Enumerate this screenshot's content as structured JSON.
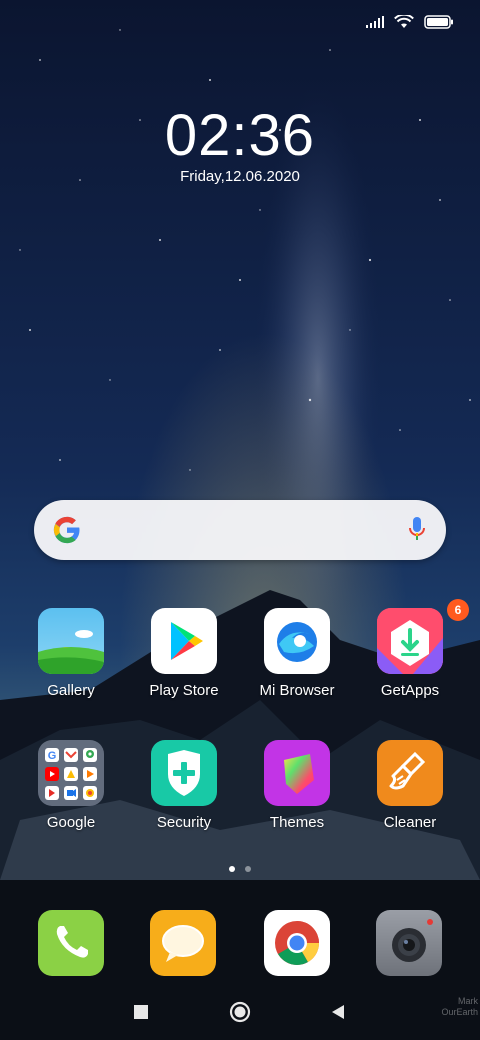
{
  "status_bar": {
    "signal_icon": "signal-icon",
    "wifi_icon": "wifi-icon",
    "battery_icon": "battery-icon"
  },
  "clock": {
    "time": "02:36",
    "date": "Friday,12.06.2020"
  },
  "search_bar": {
    "logo": "google-g-icon",
    "mic": "mic-icon"
  },
  "apps_row1": [
    {
      "label": "Gallery"
    },
    {
      "label": "Play Store"
    },
    {
      "label": "Mi Browser"
    },
    {
      "label": "GetApps",
      "badge": "6"
    }
  ],
  "apps_row2": [
    {
      "label": "Google"
    },
    {
      "label": "Security"
    },
    {
      "label": "Themes"
    },
    {
      "label": "Cleaner"
    }
  ],
  "page_indicator": {
    "pages": 2,
    "current": 1
  },
  "dock": [
    {
      "icon": "phone-icon"
    },
    {
      "icon": "messages-icon"
    },
    {
      "icon": "chrome-icon"
    },
    {
      "icon": "camera-icon"
    }
  ],
  "nav_bar": {
    "recents": "recents-icon",
    "home": "home-icon",
    "back": "back-icon"
  },
  "watermark": {
    "line1": "Mark",
    "line2": "OurEarth"
  },
  "colors": {
    "gallery": "#6fc7f0",
    "security": "#19c9a8",
    "themes": "#c23be0",
    "cleaner": "#f08a1c",
    "phone": "#8bd145",
    "messages": "#f7ad1a"
  }
}
